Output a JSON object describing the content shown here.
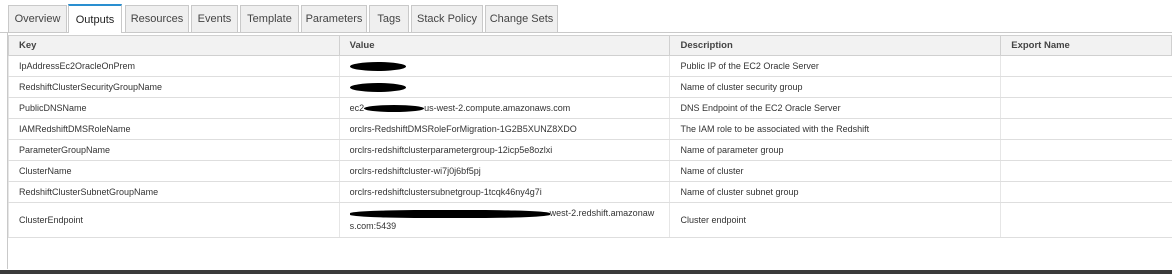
{
  "tabs": [
    {
      "label": "Overview",
      "active": false
    },
    {
      "label": "Outputs",
      "active": true
    },
    {
      "label": "Resources",
      "active": false
    },
    {
      "label": "Events",
      "active": false
    },
    {
      "label": "Template",
      "active": false
    },
    {
      "label": "Parameters",
      "active": false
    },
    {
      "label": "Tags",
      "active": false
    },
    {
      "label": "Stack Policy",
      "active": false
    },
    {
      "label": "Change Sets",
      "active": false
    }
  ],
  "outputs": {
    "columns": [
      "Key",
      "Value",
      "Description",
      "Export Name"
    ],
    "rows": [
      {
        "key": "IpAddressEc2OracleOnPrem",
        "value": "",
        "description": "Public IP of the EC2 Oracle Server",
        "export": ""
      },
      {
        "key": "RedshiftClusterSecurityGroupName",
        "value": "",
        "description": "Name of cluster security group",
        "export": ""
      },
      {
        "key": "PublicDNSName",
        "value_prefix": "ec2",
        "value_suffix": "us-west-2.compute.amazonaws.com",
        "description": "DNS Endpoint of the EC2 Oracle Server",
        "export": ""
      },
      {
        "key": "IAMRedshiftDMSRoleName",
        "value": "orclrs-RedshiftDMSRoleForMigration-1G2B5XUNZ8XDO",
        "description": "The IAM role to be associated with the Redshift",
        "export": ""
      },
      {
        "key": "ParameterGroupName",
        "value": "orclrs-redshiftclusterparametergroup-12icp5e8ozlxi",
        "description": "Name of parameter group",
        "export": ""
      },
      {
        "key": "ClusterName",
        "value": "orclrs-redshiftcluster-wi7j0j6bf5pj",
        "description": "Name of cluster",
        "export": ""
      },
      {
        "key": "RedshiftClusterSubnetGroupName",
        "value": "orclrs-redshiftclustersubnetgroup-1tcqk46ny4g7i",
        "description": "Name of cluster subnet group",
        "export": ""
      },
      {
        "key": "ClusterEndpoint",
        "value_suffix": "west-2.redshift.amazonaw",
        "value_line2": "s.com:5439",
        "description": "Cluster endpoint",
        "export": ""
      }
    ]
  }
}
